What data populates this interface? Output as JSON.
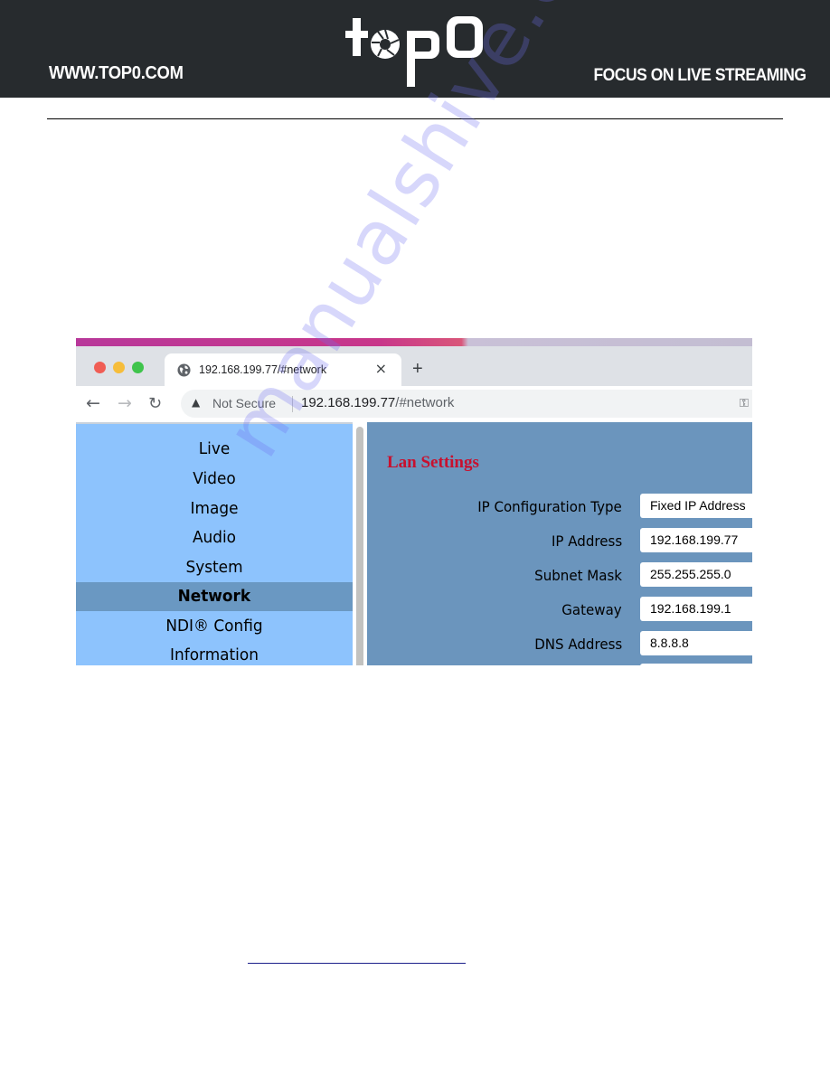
{
  "banner": {
    "site_url": "WWW.TOP0.COM",
    "brand": "top0",
    "tagline": "FOCUS ON LIVE STREAMING"
  },
  "browser": {
    "tab_title": "192.168.199.77/#network",
    "tab_close": "×",
    "new_tab": "+",
    "security_label": "Not Secure",
    "url_host": "192.168.199.77",
    "url_path": "/#network",
    "icons": {
      "back": "back-arrow-icon",
      "forward": "forward-arrow-icon",
      "reload": "reload-icon",
      "warning": "warning-icon",
      "key": "key-icon",
      "globe": "globe-icon"
    }
  },
  "sidebar": {
    "items": [
      {
        "label": "Live",
        "active": false
      },
      {
        "label": "Video",
        "active": false
      },
      {
        "label": "Image",
        "active": false
      },
      {
        "label": "Audio",
        "active": false
      },
      {
        "label": "System",
        "active": false
      },
      {
        "label": "Network",
        "active": true
      },
      {
        "label": "NDI® Config",
        "active": false
      },
      {
        "label": "Information",
        "active": false
      }
    ]
  },
  "lan_settings": {
    "title": "Lan Settings",
    "fields": [
      {
        "label": "IP Configuration Type",
        "value": "Fixed IP Address"
      },
      {
        "label": "IP Address",
        "value": "192.168.199.77"
      },
      {
        "label": "Subnet Mask",
        "value": "255.255.255.0"
      },
      {
        "label": "Gateway",
        "value": "192.168.199.1"
      },
      {
        "label": "DNS Address",
        "value": "8.8.8.8"
      }
    ]
  },
  "watermark": "manualshive.com",
  "colors": {
    "banner_bg": "#272b2e",
    "sidebar_bg": "#8dc3fd",
    "sidebar_active": "#6a98c2",
    "main_bg": "#6b95bd",
    "title_red": "#c8102e"
  }
}
